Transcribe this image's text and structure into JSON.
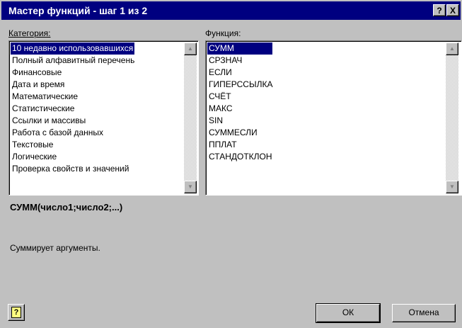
{
  "window": {
    "title": "Мастер функций - шаг 1 из 2",
    "help_button": "?",
    "close_button": "X"
  },
  "category": {
    "label": "Категория:",
    "items": [
      "10 недавно использовавшихся",
      "Полный алфавитный перечень",
      "Финансовые",
      "Дата и время",
      "Математические",
      "Статистические",
      "Ссылки и массивы",
      "Работа с базой данных",
      "Текстовые",
      "Логические",
      "Проверка свойств и значений"
    ],
    "selected_index": 0
  },
  "function": {
    "label": "Функция:",
    "items": [
      "СУММ",
      "СРЗНАЧ",
      "ЕСЛИ",
      "ГИПЕРССЫЛКА",
      "СЧЁТ",
      "МАКС",
      "SIN",
      "СУММЕСЛИ",
      "ППЛАТ",
      "СТАНДОТКЛОН"
    ],
    "selected_index": 0
  },
  "details": {
    "syntax": "СУММ(число1;число2;...)",
    "description": "Суммирует аргументы."
  },
  "buttons": {
    "ok": "ОК",
    "cancel": "Отмена",
    "help_icon": "help-icon"
  },
  "colors": {
    "titlebar": "#000080",
    "face": "#c0c0c0",
    "selection": "#000080"
  }
}
